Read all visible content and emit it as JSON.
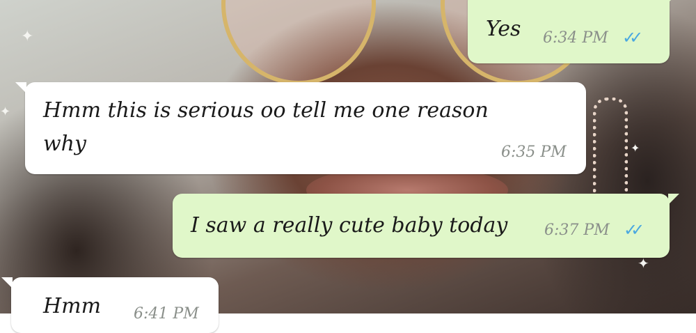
{
  "conversation": {
    "messages": [
      {
        "direction": "outgoing",
        "text": "Yes",
        "time": "6:34 PM",
        "status": "read"
      },
      {
        "direction": "incoming",
        "text": "Hmm this is serious oo tell me one reason\nwhy",
        "time": "6:35 PM"
      },
      {
        "direction": "outgoing",
        "text": "I saw a really cute baby today",
        "time": "6:37 PM",
        "status": "read"
      },
      {
        "direction": "incoming",
        "text": "Hmm",
        "time": "6:41 PM"
      }
    ]
  },
  "icons": {
    "read_receipt": "double-check-icon",
    "read_receipt_glyph": "✓✓",
    "sparkle_glyph": "✦"
  },
  "colors": {
    "incoming_bubble": "#ffffff",
    "outgoing_bubble": "#e0f7c9",
    "read_tick": "#4aa8e0",
    "timestamp": "#8a8f8a"
  }
}
